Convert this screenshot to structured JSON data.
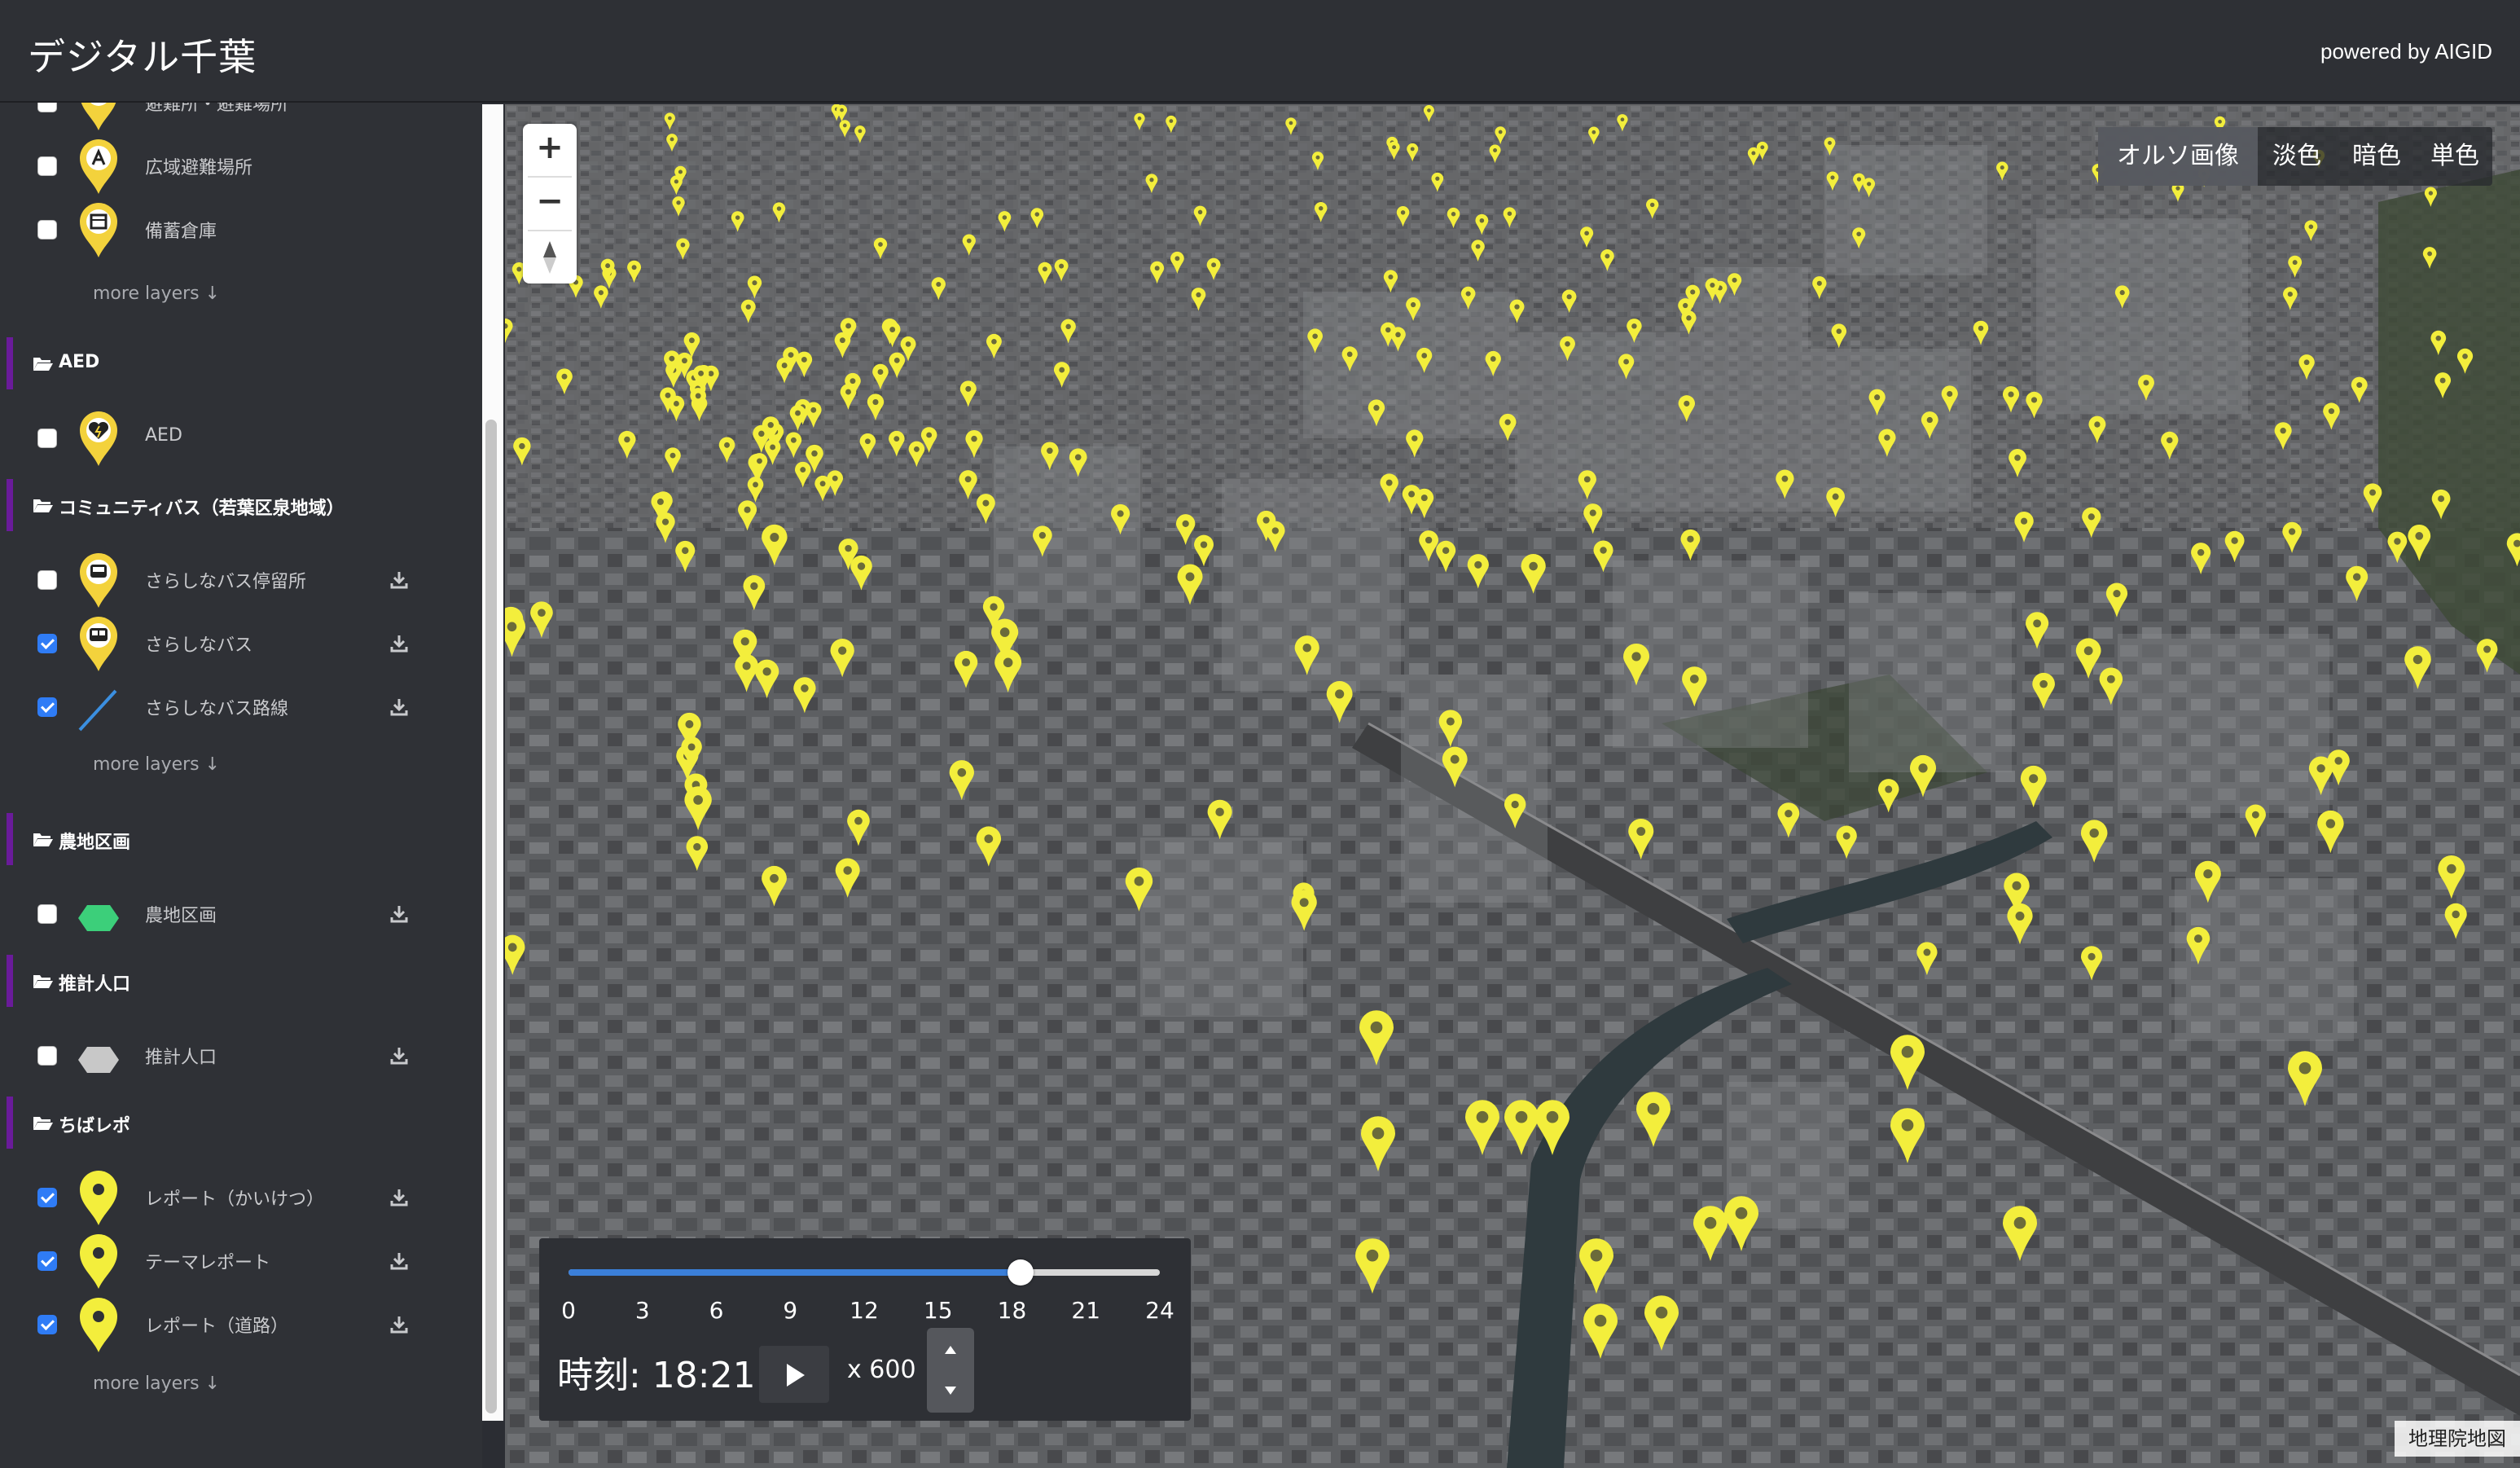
{
  "header": {
    "app_title": "デジタル千葉",
    "powered_by": "powered by AIGID"
  },
  "sidebar": {
    "top_rows": [
      {
        "label": "避難所・避難場所",
        "checked": false,
        "icon": "evacuation-shelter-pin-icon"
      },
      {
        "label": "広域避難場所",
        "checked": false,
        "icon": "wide-area-evacuation-pin-icon"
      },
      {
        "label": "備蓄倉庫",
        "checked": false,
        "icon": "stockpile-warehouse-pin-icon"
      }
    ],
    "more_layers_1": "more layers ↓",
    "groups": [
      {
        "title": "AED",
        "rows": [
          {
            "label": "AED",
            "checked": false,
            "download": false,
            "icon": "aed-heart-pin-icon"
          }
        ]
      },
      {
        "title": "コミュニティバス（若葉区泉地域）",
        "rows": [
          {
            "label": "さらしなバス停留所",
            "checked": false,
            "download": true,
            "icon": "bus-stop-pin-icon"
          },
          {
            "label": "さらしなバス",
            "checked": true,
            "download": true,
            "icon": "bus-pin-icon"
          },
          {
            "label": "さらしなバス路線",
            "checked": true,
            "download": true,
            "icon": "bus-route-line-icon"
          }
        ],
        "more": "more layers ↓"
      },
      {
        "title": "農地区画",
        "rows": [
          {
            "label": "農地区画",
            "checked": false,
            "download": true,
            "icon": "farmland-hexagon-icon",
            "color": "#3ccf7a"
          }
        ]
      },
      {
        "title": "推計人口",
        "rows": [
          {
            "label": "推計人口",
            "checked": false,
            "download": true,
            "icon": "population-hexagon-icon",
            "color": "#c8c8c8"
          }
        ]
      },
      {
        "title": "ちばレポ",
        "rows": [
          {
            "label": "レポート（かいけつ）",
            "checked": true,
            "download": true,
            "icon": "report-pin-icon"
          },
          {
            "label": "テーマレポート",
            "checked": true,
            "download": true,
            "icon": "theme-report-pin-icon"
          },
          {
            "label": "レポート（道路）",
            "checked": true,
            "download": true,
            "icon": "road-report-pin-icon"
          }
        ],
        "more": "more layers ↓"
      }
    ]
  },
  "map": {
    "zoom_in": "+",
    "zoom_out": "−",
    "basemaps": [
      {
        "label": "オルソ画像",
        "active": true
      },
      {
        "label": "淡色",
        "active": false
      },
      {
        "label": "暗色",
        "active": false
      },
      {
        "label": "単色",
        "active": false
      }
    ],
    "attribution": "地理院地図",
    "pin_color": "#f3ee3c"
  },
  "time_panel": {
    "ticks": [
      "0",
      "3",
      "6",
      "9",
      "12",
      "15",
      "18",
      "21",
      "24"
    ],
    "slider_value_hours": 18.35,
    "slider_max_hours": 24,
    "time_label": "時刻: 18:21",
    "speed_label": "x 600",
    "accent": "#3b7fd9"
  }
}
